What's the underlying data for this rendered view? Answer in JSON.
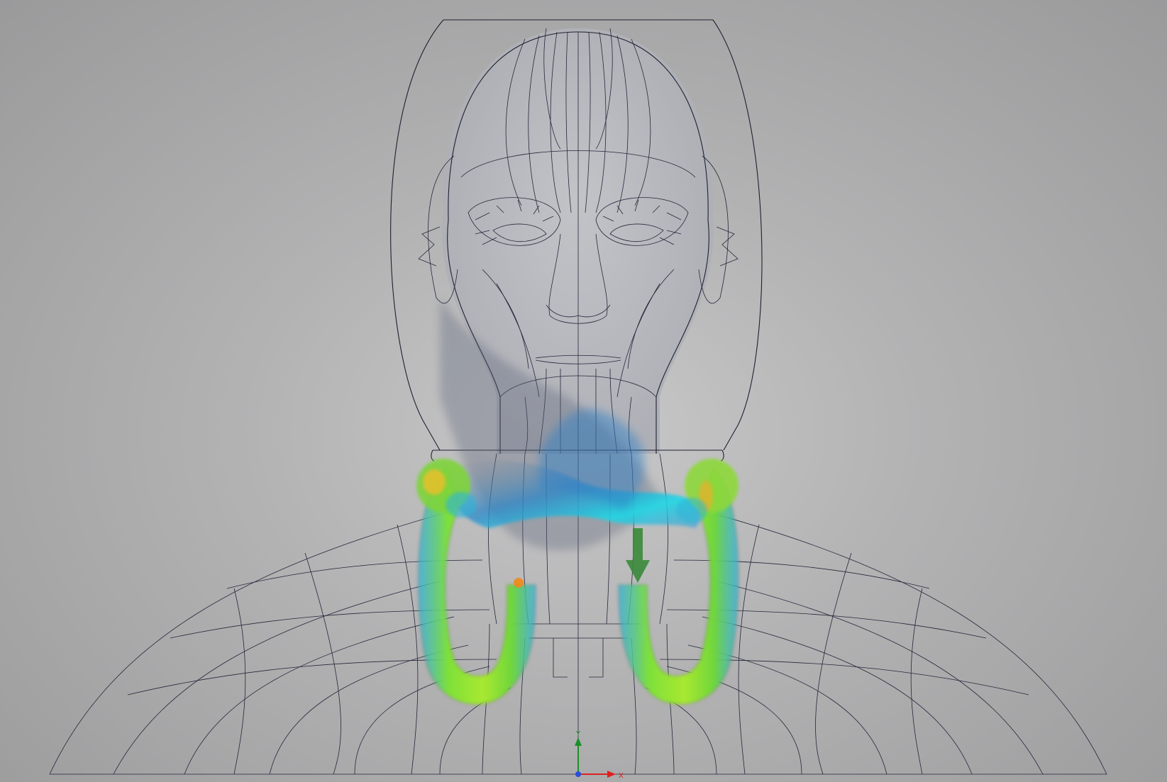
{
  "viewport": {
    "background_top": "#9a9a9b",
    "background_center": "#c8c8c9"
  },
  "triad": {
    "y_label": "Y",
    "x_label": "X",
    "y_color": "#1a8f2a",
    "x_color": "#e02020",
    "origin_color": "#2a4fd8"
  },
  "colors": {
    "wireframe": "#1f2030",
    "flow_green": "#8fe03a",
    "flow_yellow": "#e8d02a",
    "flow_cyan": "#1fd0e8",
    "flow_blue": "#2b8fd8",
    "load_arrow": "#3a8a3a",
    "marker_orange": "#f08a1a"
  },
  "icons": [
    "coordinate-triad-icon",
    "load-arrow-icon",
    "probe-marker-icon"
  ]
}
